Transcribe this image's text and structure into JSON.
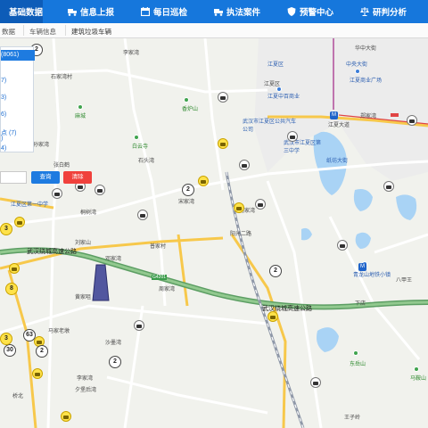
{
  "nav": {
    "items": [
      {
        "label": "基础数据",
        "icon": "grid-icon"
      },
      {
        "label": "信息上报",
        "icon": "truck-icon"
      },
      {
        "label": "每日巡检",
        "icon": "calendar-icon"
      },
      {
        "label": "执法案件",
        "icon": "truck-icon"
      },
      {
        "label": "预警中心",
        "icon": "shield-icon"
      },
      {
        "label": "研判分析",
        "icon": "scale-icon"
      }
    ],
    "active_index": 0,
    "colors": {
      "bar": "#1677dc",
      "active": "#0d5cb8"
    }
  },
  "breadcrumb": {
    "items": [
      "数据",
      "车辆信息",
      "建筑垃圾车辆"
    ]
  },
  "panel": {
    "selected": "(8061)",
    "items": [
      "7)",
      "3)",
      "6)",
      "点 (7)",
      ")",
      "4)"
    ]
  },
  "search": {
    "placeholder": "",
    "search_label": "查询",
    "clear_label": "清除"
  },
  "map": {
    "labels": [
      {
        "text": "石家湾村",
        "cls": ""
      },
      {
        "text": "麻城",
        "cls": ""
      },
      {
        "text": "孙家湾",
        "cls": ""
      },
      {
        "text": "张白鹤",
        "cls": ""
      },
      {
        "text": "白云寺",
        "cls": "green"
      },
      {
        "text": "石头湾",
        "cls": ""
      },
      {
        "text": "香炉山",
        "cls": "green"
      },
      {
        "text": "李家湾",
        "cls": ""
      },
      {
        "text": "华中大街",
        "cls": ""
      },
      {
        "text": "江夏区",
        "cls": "blue"
      },
      {
        "text": "中央大街",
        "cls": "blue"
      },
      {
        "text": "江夏商业广场",
        "cls": "blue"
      },
      {
        "text": "江夏区",
        "cls": ""
      },
      {
        "text": "武汉市江夏区公共汽车公司",
        "cls": "blue"
      },
      {
        "text": "江夏大道",
        "cls": ""
      },
      {
        "text": "郑家湾",
        "cls": ""
      },
      {
        "text": "江夏中百商业",
        "cls": "blue"
      },
      {
        "text": "纸坊大街",
        "cls": "blue"
      },
      {
        "text": "武汉市江夏区第三中学",
        "cls": "blue"
      },
      {
        "text": "江夏区第一中学",
        "cls": "blue"
      },
      {
        "text": "何家湾",
        "cls": ""
      },
      {
        "text": "桐树湾",
        "cls": ""
      },
      {
        "text": "宋家湾",
        "cls": ""
      },
      {
        "text": "普家村",
        "cls": ""
      },
      {
        "text": "阳光二路",
        "cls": ""
      },
      {
        "text": "武汉绕城高速公路",
        "cls": "exp"
      },
      {
        "text": "G4201",
        "cls": ""
      },
      {
        "text": "黄家咀",
        "cls": ""
      },
      {
        "text": "刘家山",
        "cls": ""
      },
      {
        "text": "邓家湾",
        "cls": ""
      },
      {
        "text": "周家湾",
        "cls": ""
      },
      {
        "text": "沙墨湾",
        "cls": ""
      },
      {
        "text": "马家老墩",
        "cls": ""
      },
      {
        "text": "李家湾",
        "cls": ""
      },
      {
        "text": "夕堡后湾",
        "cls": ""
      },
      {
        "text": "桥北",
        "cls": ""
      },
      {
        "text": "武汉绕城高速公路",
        "cls": "exp"
      },
      {
        "text": "下店",
        "cls": ""
      },
      {
        "text": "八甲王",
        "cls": ""
      },
      {
        "text": "东岳山",
        "cls": "green"
      },
      {
        "text": "马鞍山",
        "cls": "green"
      },
      {
        "text": "青龙山地铁小镇",
        "cls": "blue"
      },
      {
        "text": "王子岭",
        "cls": ""
      }
    ],
    "clusters": [
      "2",
      "3",
      "2",
      "8",
      "63",
      "2",
      "30",
      "2",
      "3",
      "2"
    ]
  }
}
